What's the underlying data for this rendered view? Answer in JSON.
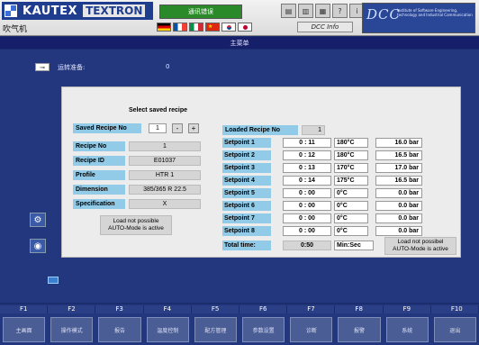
{
  "header": {
    "logo_kautex": "KAUTEX",
    "logo_textron": "TEXTRON",
    "machine_name": "吹气机",
    "status_text": "通讯错误",
    "dcc_info": "DCC Info",
    "dcc_logo": "DCC",
    "dcc_tagline": "Institute of Software Engineering, technology and Industrial Communication"
  },
  "page_title": "主菜单",
  "status_row": {
    "label": "运转准备:",
    "value": "0"
  },
  "dialog": {
    "title": "Select saved recipe",
    "saved_recipe_no_label": "Saved Recipe No",
    "saved_recipe_no_value": "1",
    "minus_label": "-",
    "plus_label": "+",
    "recipe_fields": [
      {
        "label": "Recipe No",
        "value": "1"
      },
      {
        "label": "Recipe ID",
        "value": "E01037"
      },
      {
        "label": "Profile",
        "value": "HTR 1"
      },
      {
        "label": "Dimension",
        "value": "385/365 R 22.5"
      },
      {
        "label": "Specification",
        "value": "X"
      }
    ],
    "left_note_line1": "Load not possible",
    "left_note_line2": "AUTO-Mode is active",
    "loaded_recipe_label": "Loaded Recipe No",
    "loaded_recipe_value": "1",
    "setpoints": [
      {
        "label": "Setpoint 1",
        "time": "0  :  11",
        "temp": "180°C",
        "pressure": "16.0 bar"
      },
      {
        "label": "Setpoint 2",
        "time": "0  :  12",
        "temp": "180°C",
        "pressure": "16.5 bar"
      },
      {
        "label": "Setpoint 3",
        "time": "0  :  13",
        "temp": "170°C",
        "pressure": "17.0 bar"
      },
      {
        "label": "Setpoint 4",
        "time": "0  :  14",
        "temp": "175°C",
        "pressure": "16.5 bar"
      },
      {
        "label": "Setpoint 5",
        "time": "0  :  00",
        "temp": "0°C",
        "pressure": "0.0 bar"
      },
      {
        "label": "Setpoint 6",
        "time": "0  :  00",
        "temp": "0°C",
        "pressure": "0.0 bar"
      },
      {
        "label": "Setpoint 7",
        "time": "0  :  00",
        "temp": "0°C",
        "pressure": "0.0 bar"
      },
      {
        "label": "Setpoint 8",
        "time": "0  :  00",
        "temp": "0°C",
        "pressure": "0.0 bar"
      }
    ],
    "total_time_label": "Total time:",
    "total_time_value": "0:50",
    "total_time_unit": "Min:Sec",
    "right_note_line1": "Load not possibel",
    "right_note_line2": "AUTO-Mode is active"
  },
  "function_keys": [
    {
      "key": "F1",
      "label": "主画面"
    },
    {
      "key": "F2",
      "label": "操作模式"
    },
    {
      "key": "F3",
      "label": "报告"
    },
    {
      "key": "F4",
      "label": "温度控制"
    },
    {
      "key": "F5",
      "label": "配方管理"
    },
    {
      "key": "F6",
      "label": "参数设置"
    },
    {
      "key": "F7",
      "label": "诊断"
    },
    {
      "key": "F8",
      "label": "报警"
    },
    {
      "key": "F9",
      "label": "系统"
    },
    {
      "key": "F10",
      "label": "退出"
    }
  ]
}
